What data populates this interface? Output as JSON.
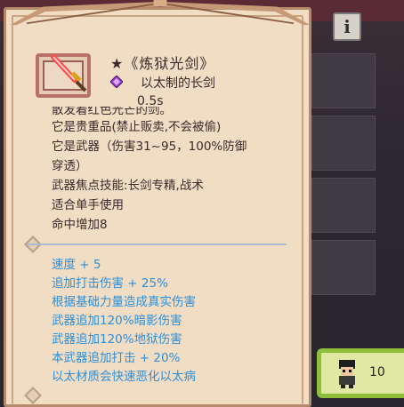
{
  "item": {
    "title": "★《炼狱光剑》",
    "subtitle": "以太制的长剑",
    "speed": "0.5s",
    "description_cut": "散发着红色光芒的剑。",
    "description": [
      "它是贵重品(禁止贩卖,不会被偷)",
      "它是武器（伤害31~95，100%防御",
      "穿透）",
      "武器焦点技能:长剑专精,战术",
      "适合单手使用",
      "命中增加8"
    ],
    "stats": [
      "速度 + 5",
      "追加打击伤害 + 25%",
      "根据基础力量造成真实伤害",
      "武器追加120%暗影伤害",
      "武器追加120%地狱伤害",
      "本武器追加打击 + 20%",
      "以太材质会快速恶化以太病"
    ]
  },
  "info_button": {
    "label": "i",
    "icon": "info-icon"
  },
  "party": {
    "count": "10",
    "icon": "character-avatar"
  },
  "colors": {
    "tooltip_bg": "#f1dcc4",
    "tooltip_border": "#b58a6a",
    "stat_text": "#2f8fd8",
    "counter_border": "#8fbe3a"
  }
}
